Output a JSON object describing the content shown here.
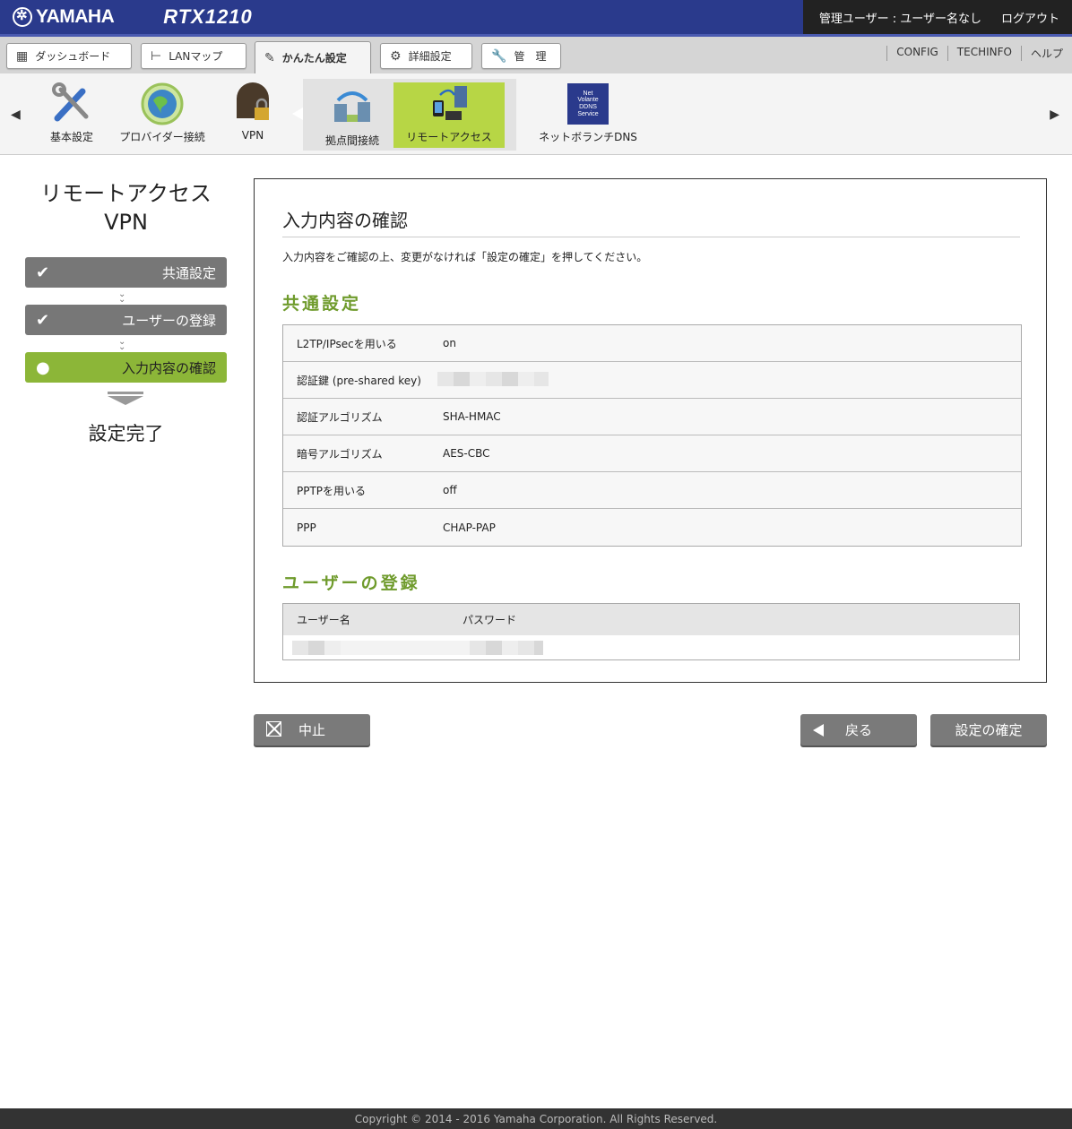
{
  "header": {
    "brand": "YAMAHA",
    "model": "RTX1210",
    "user_label": "管理ユーザー : ユーザー名なし",
    "logout": "ログアウト"
  },
  "nav": {
    "tabs": [
      {
        "label": "ダッシュボード",
        "icon": "dashboard-icon"
      },
      {
        "label": "LANマップ",
        "icon": "lanmap-icon"
      },
      {
        "label": "かんたん設定",
        "icon": "wand-icon",
        "active": true
      },
      {
        "label": "詳細設定",
        "icon": "gear-icon"
      },
      {
        "label": "管　理",
        "icon": "wrench-icon"
      }
    ],
    "links": [
      "CONFIG",
      "TECHINFO",
      "ヘルプ"
    ]
  },
  "icon_strip": {
    "items": [
      {
        "label": "基本設定",
        "icon": "tools-icon"
      },
      {
        "label": "プロバイダー接続",
        "icon": "globe-icon"
      },
      {
        "label": "VPN",
        "icon": "vpn-lock-icon"
      },
      {
        "label": "拠点間接続",
        "icon": "site-to-site-icon"
      },
      {
        "label": "リモートアクセス",
        "icon": "remote-access-icon",
        "selected": true
      },
      {
        "label": "ネットボランチDNS",
        "icon": "ddns-icon",
        "badge": [
          "Net",
          "Volante",
          "DDNS",
          "Service"
        ]
      }
    ]
  },
  "wizard": {
    "title": "リモートアクセス",
    "subtitle": "VPN",
    "steps": [
      {
        "label": "共通設定",
        "state": "done"
      },
      {
        "label": "ユーザーの登録",
        "state": "done"
      },
      {
        "label": "入力内容の確認",
        "state": "current"
      }
    ],
    "final": "設定完了"
  },
  "confirm": {
    "heading": "入力内容の確認",
    "description": "入力内容をご確認の上、変更がなければ「設定の確定」を押してください。",
    "common_title": "共通設定",
    "common_rows": [
      {
        "key": "L2TP/IPsecを用いる",
        "value": "on"
      },
      {
        "key": "認証鍵 (pre-shared key)",
        "value": ""
      },
      {
        "key": "認証アルゴリズム",
        "value": "SHA-HMAC"
      },
      {
        "key": "暗号アルゴリズム",
        "value": "AES-CBC"
      },
      {
        "key": "PPTPを用いる",
        "value": "off"
      },
      {
        "key": "PPP",
        "value": "CHAP-PAP"
      }
    ],
    "users_title": "ユーザーの登録",
    "users_headers": [
      "ユーザー名",
      "パスワード"
    ]
  },
  "buttons": {
    "cancel": "中止",
    "back": "戻る",
    "confirm": "設定の確定"
  },
  "footer": "Copyright © 2014 - 2016 Yamaha Corporation. All Rights Reserved.",
  "colors": {
    "header_bg": "#2a3a8c",
    "accent_green": "#8cb638",
    "section_green": "#6f9b2c",
    "button_gray": "#7a7a7a"
  }
}
